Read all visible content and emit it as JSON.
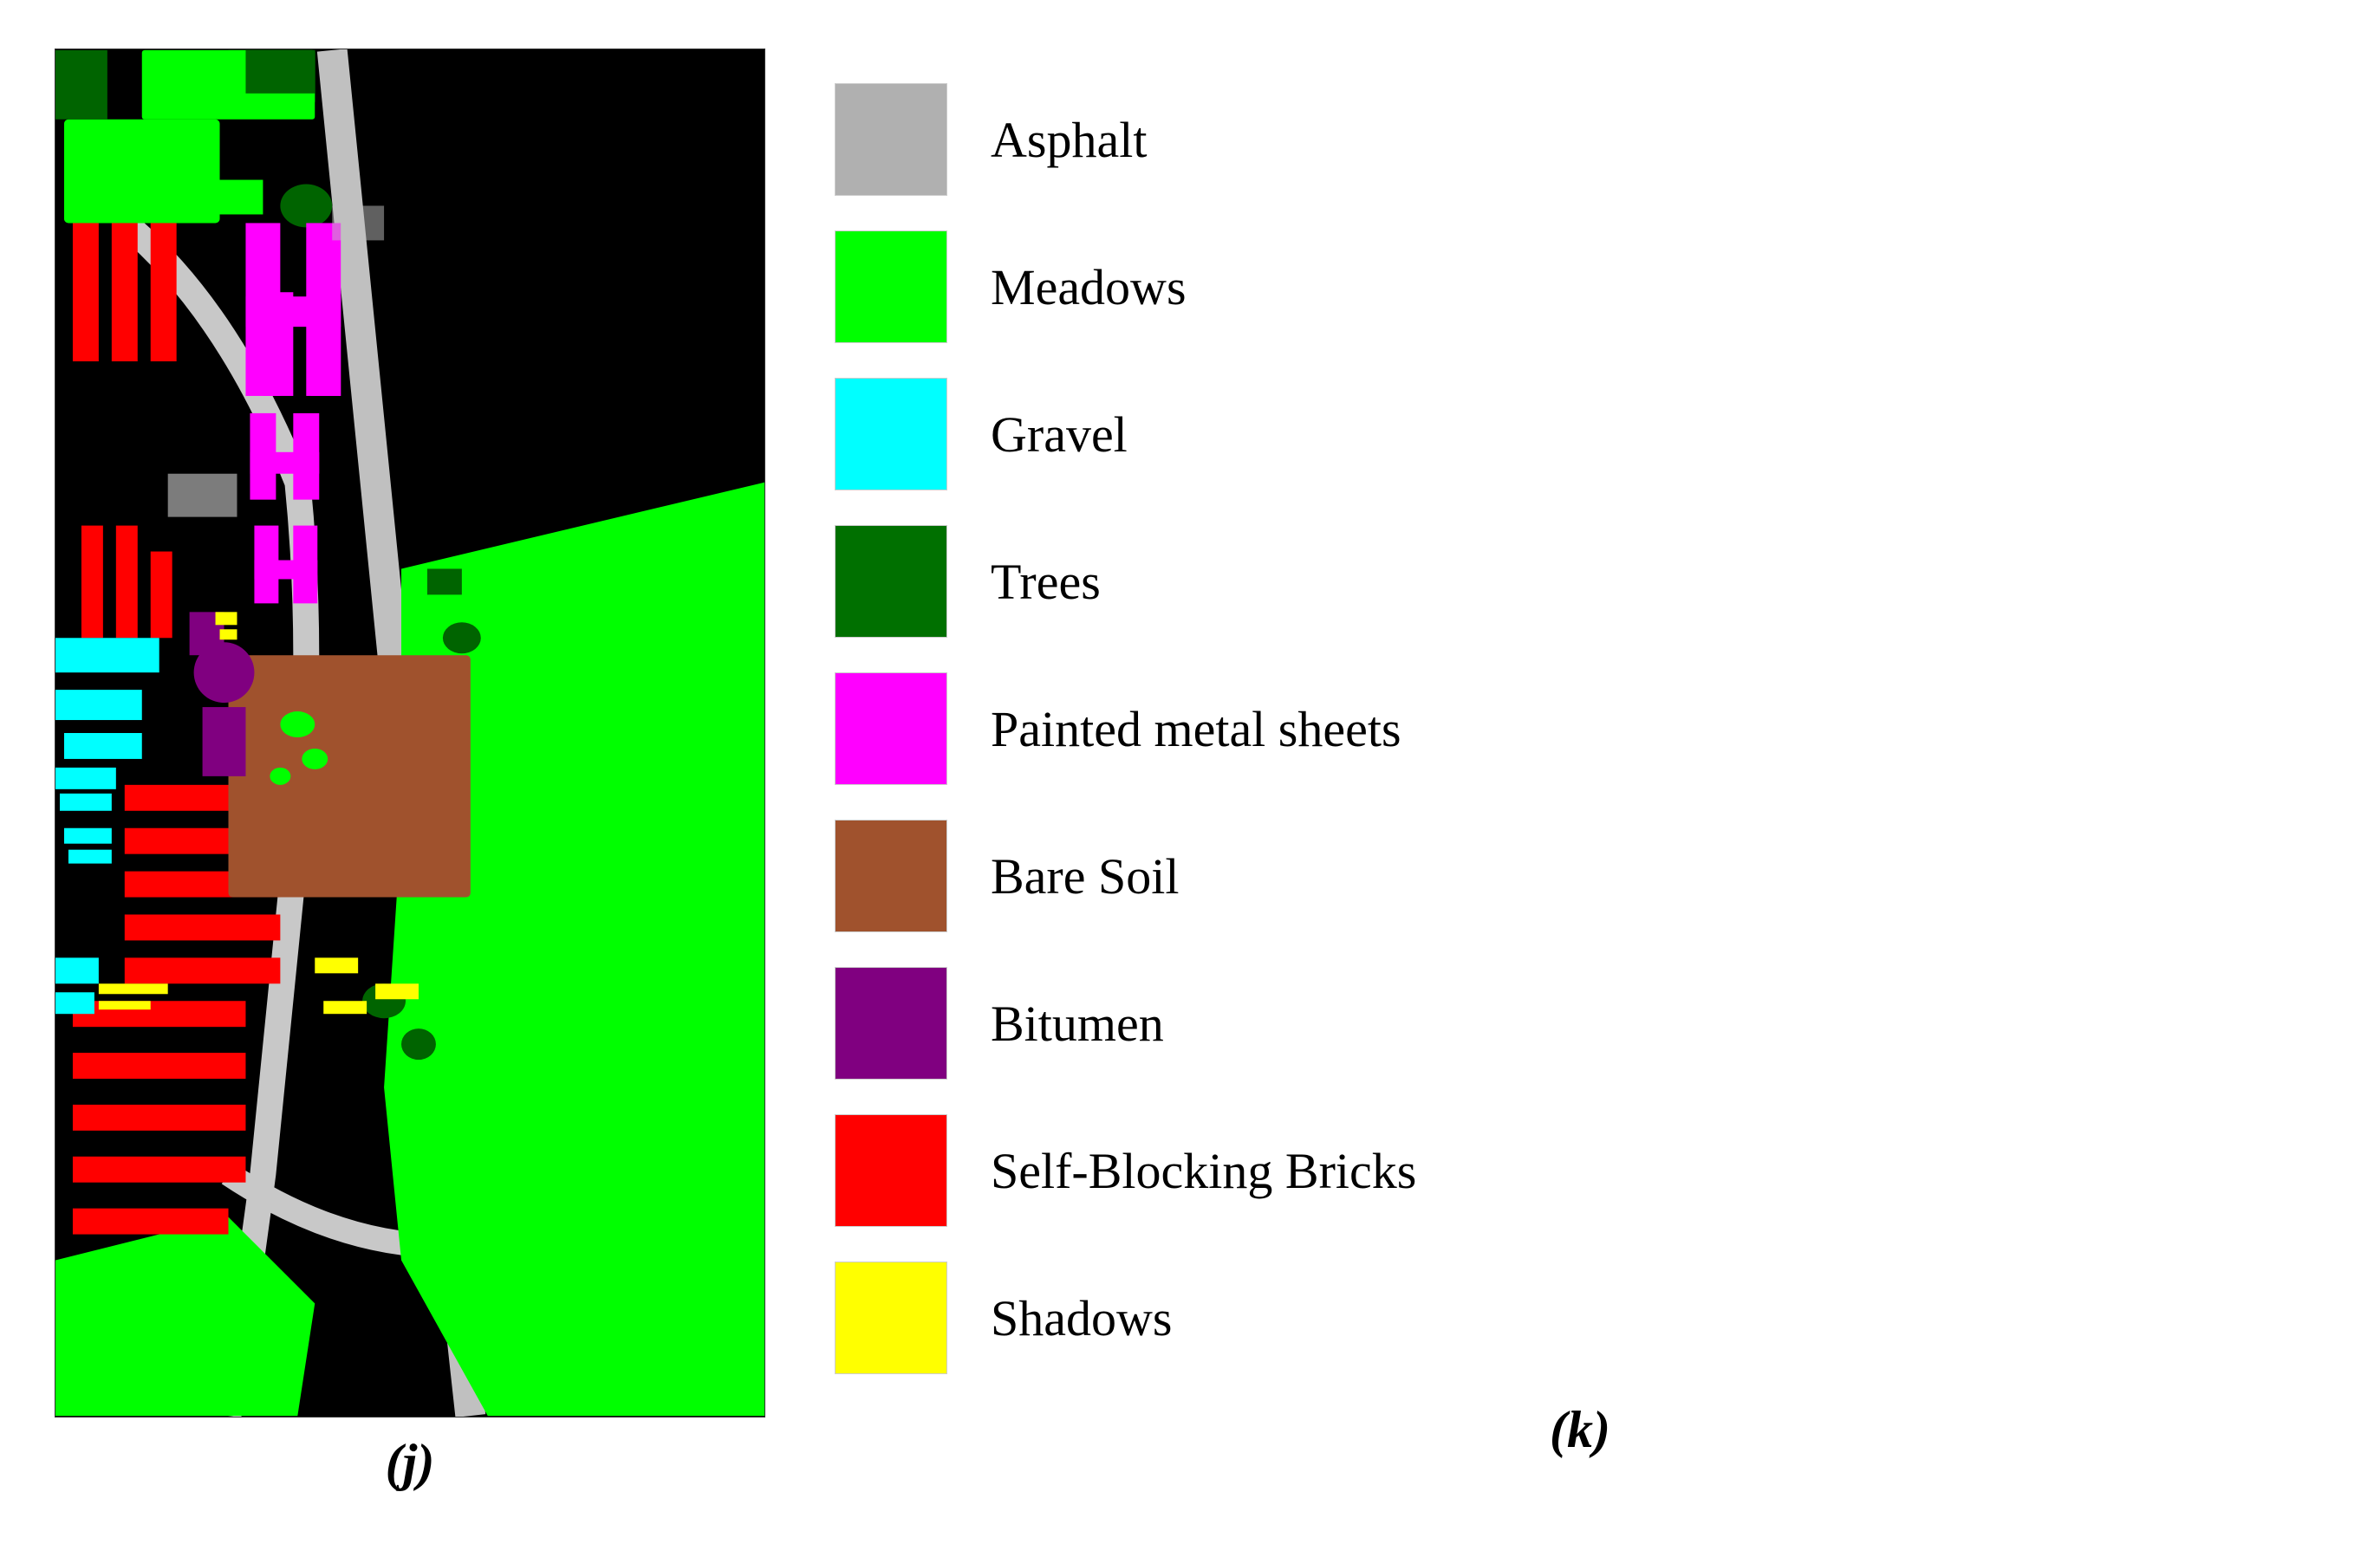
{
  "map": {
    "label": "(j)"
  },
  "legend": {
    "label": "(k)",
    "items": [
      {
        "id": "asphalt",
        "color": "#b0b0b0",
        "label": "Asphalt"
      },
      {
        "id": "meadows",
        "color": "#00ff00",
        "label": "Meadows"
      },
      {
        "id": "gravel",
        "color": "#00ffff",
        "label": "Gravel"
      },
      {
        "id": "trees",
        "color": "#007000",
        "label": "Trees"
      },
      {
        "id": "painted-metal-sheets",
        "color": "#ff00ff",
        "label": "Painted metal sheets"
      },
      {
        "id": "bare-soil",
        "color": "#a0522d",
        "label": "Bare Soil"
      },
      {
        "id": "bitumen",
        "color": "#800080",
        "label": "Bitumen"
      },
      {
        "id": "self-blocking-bricks",
        "color": "#ff0000",
        "label": "Self-Blocking Bricks"
      },
      {
        "id": "shadows",
        "color": "#ffff00",
        "label": "Shadows"
      }
    ]
  }
}
